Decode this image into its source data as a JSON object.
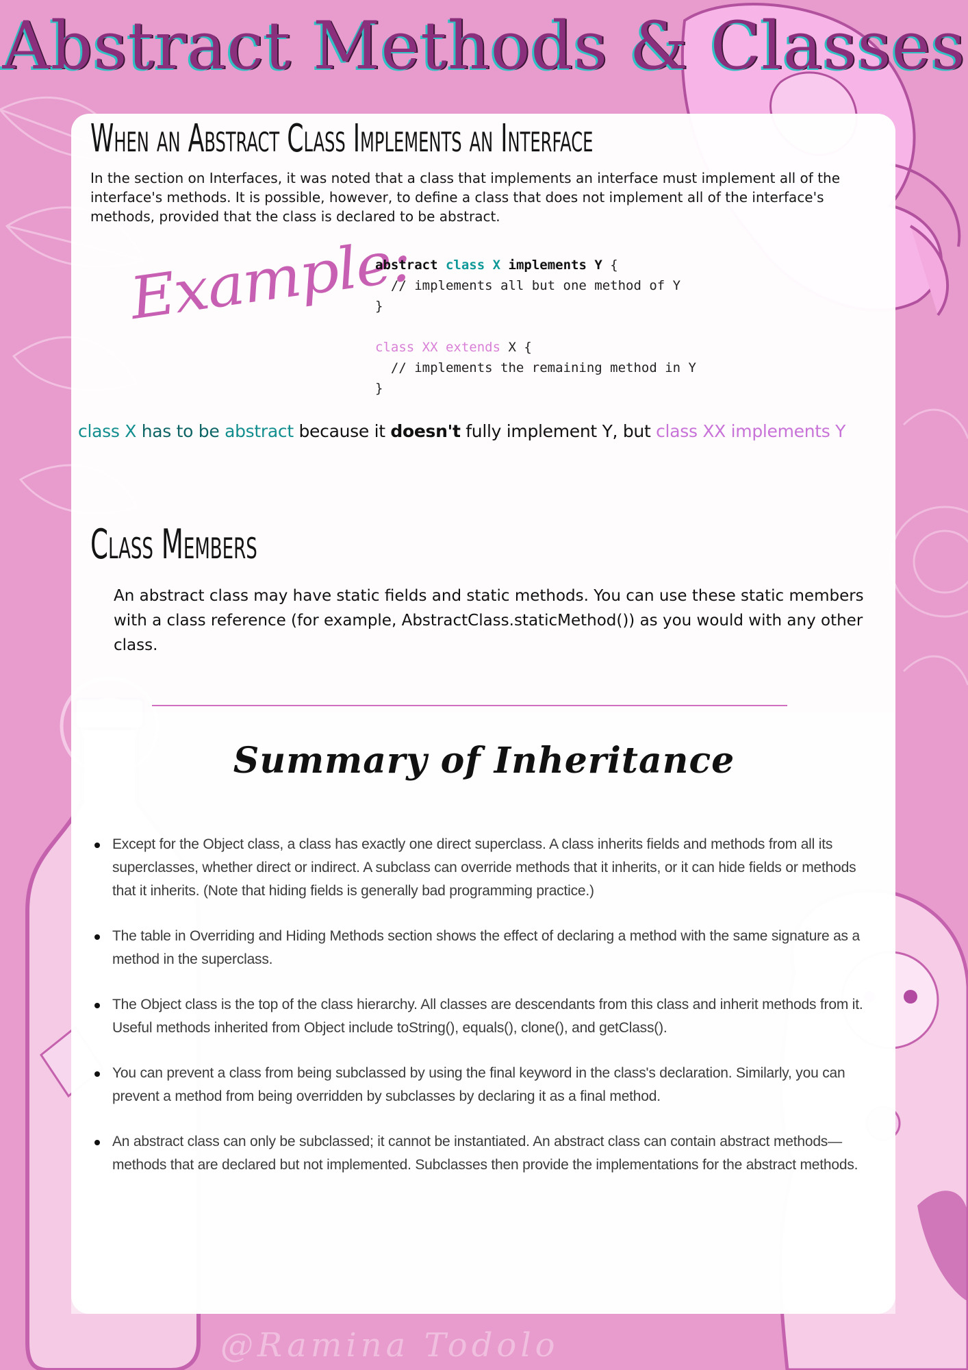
{
  "header": {
    "title": "Abstract Methods & Classes"
  },
  "abstract_section": {
    "heading": "When an Abstract Class Implements an Interface",
    "intro": "In the section on Interfaces, it was noted that a class that implements an interface must implement all of the interface's methods. It is possible, however, to define a class that does not implement all of the interface's methods, provided that the class is declared to be abstract.",
    "example_label": "Example:",
    "code": {
      "line1_kw1": "abstract",
      "line1_kw2": "class X",
      "line1_kw3": "implements Y",
      "line1_rest": " {",
      "line2": "  // implements all but one method of Y",
      "line3": "}",
      "line5_kw": "class XX extends",
      "line5_rest": " X {",
      "line6": "  // implements the remaining method in Y",
      "line7": "}"
    },
    "conclusion": {
      "part1": "class X",
      "part2": " has to be ",
      "part3": "abstract",
      "part4": " because it ",
      "part5": "doesn't",
      "part6": " fully implement Y, but ",
      "part7": "class XX implements Y"
    }
  },
  "members_section": {
    "heading": "Class Members",
    "text": "An abstract class may have static fields and static methods. You can use these static members with a class reference (for example, AbstractClass.staticMethod()) as you would with any other class."
  },
  "summary_section": {
    "title": "Summary of Inheritance",
    "items": [
      "Except for the Object class, a class has exactly one direct superclass. A class inherits fields and methods from all its superclasses, whether direct or indirect. A subclass can override methods that it inherits, or it can hide fields or methods that it inherits. (Note that hiding fields is generally bad programming practice.)",
      "The table in Overriding and Hiding Methods section shows the effect of declaring a method with the same signature as a method in the superclass.",
      "The Object class is the top of the class hierarchy. All classes are descendants from this class and inherit methods from it. Useful methods inherited from Object include toString(), equals(), clone(), and getClass().",
      "You can prevent a class from being subclassed by using the final keyword in the class's declaration. Similarly, you can prevent a method from being overridden by subclasses by declaring it as a final method.",
      "An abstract class can only be subclassed; it cannot be instantiated. An abstract class can contain abstract methods—methods that are declared but not implemented. Subclasses then provide the implementations for the abstract methods."
    ]
  },
  "footer": {
    "signature": "@Ramina Todolo"
  },
  "colors": {
    "background": "#e89ccd",
    "title": "#8a2f7c",
    "teal_accent": "#109999",
    "pink_accent": "#c873d8",
    "divider": "#d06fc0"
  },
  "decorations": [
    "rose-illustration",
    "leaf-illustration",
    "bottle-illustration",
    "nesting-doll-illustration"
  ]
}
